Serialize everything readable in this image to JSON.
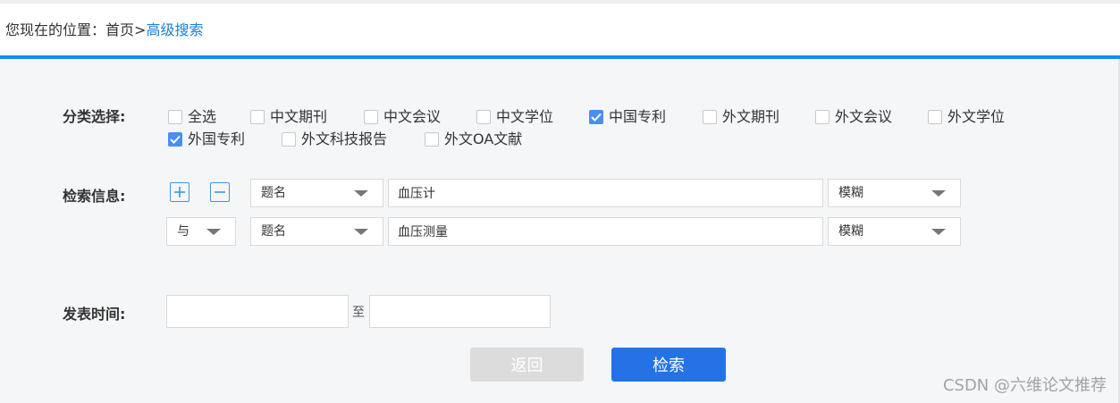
{
  "breadcrumb": {
    "prefix": "您现在的位置：",
    "home": "首页",
    "separator": ">",
    "current": "高级搜索"
  },
  "category": {
    "label": "分类选择:",
    "options": [
      {
        "label": "全选",
        "checked": false
      },
      {
        "label": "中文期刊",
        "checked": false
      },
      {
        "label": "中文会议",
        "checked": false
      },
      {
        "label": "中文学位",
        "checked": false
      },
      {
        "label": "中国专利",
        "checked": true
      },
      {
        "label": "外文期刊",
        "checked": false
      },
      {
        "label": "外文会议",
        "checked": false
      },
      {
        "label": "外文学位",
        "checked": false
      },
      {
        "label": "外国专利",
        "checked": true
      },
      {
        "label": "外文科技报告",
        "checked": false
      },
      {
        "label": "外文OA文献",
        "checked": false
      }
    ]
  },
  "search_info": {
    "label": "检索信息:",
    "add_icon": "plus-square-icon",
    "remove_icon": "minus-square-icon",
    "rows": [
      {
        "field": "题名",
        "value": "血压计",
        "match": "模糊"
      },
      {
        "logic": "与",
        "field": "题名",
        "value": "血压测量",
        "match": "模糊"
      }
    ]
  },
  "publish_time": {
    "label": "发表时间:",
    "from": "",
    "separator": "至",
    "to": ""
  },
  "buttons": {
    "back": "返回",
    "search": "检索"
  },
  "watermark": "CSDN @六维论文推荐",
  "colors": {
    "accent": "#1a8cf0",
    "primary_button": "#2572e6",
    "checkbox_checked": "#4a8ef4",
    "disabled_button": "#dcdcdc"
  }
}
